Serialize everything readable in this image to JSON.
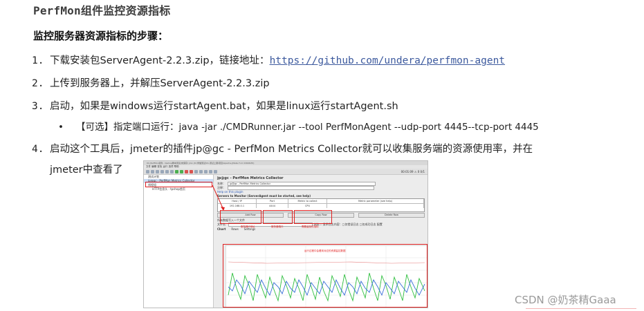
{
  "heading": "PerfMon组件监控资源指标",
  "subheading": "监控服务器资源指标的步骤：",
  "steps": [
    {
      "num": "1.",
      "text": "下载安装包ServerAgent-2.2.3.zip，链接地址：",
      "link": "https://github.com/undera/perfmon-agent"
    },
    {
      "num": "2.",
      "text": "上传到服务器上，并解压ServerAgent-2.2.3.zip"
    },
    {
      "num": "3.",
      "text": "启动，如果是windows运行startAgent.bat，如果是linux运行startAgent.sh"
    },
    {
      "num": "4.",
      "text": "启动这个工具后，jmeter的插件jp@gc - PerfMon Metrics Collector就可以收集服务端的资源使用率，并在",
      "cont": "jmeter中查看了"
    }
  ],
  "bullet": {
    "dot": "•",
    "text": "【可选】指定端口运行：java -jar ./CMDRunner.jar --tool PerfMonAgent --udp-port 4445--tcp-port 4445"
  },
  "screenshot": {
    "window_title": "04_PerfMon组件 - tpshop脚本测试(未保存)  jmx (D:\\学堂测试\\01-测试上课\\项目\\Apache-JMeter 5.0 r1840935)",
    "menu": "文件  编辑  查找  运行  选项  帮助",
    "timer": "00:01:09  ⚠ 0  0/1",
    "tree": [
      "测试计划",
      "jp@gc - PerfMon Metrics Collector",
      "线程组",
      "HTTP信息头 - tpshop首页"
    ],
    "panel_title": "jp@gc - PerfMon Metrics Collector",
    "name_label": "名称：",
    "name_value": "jp@gc - PerfMon Metrics Collector",
    "comment_label": "注释：",
    "help_link": "Help on this plugin",
    "section": "Servers to Monitor (ServerAgent must be started, see help)",
    "columns": [
      "Host / IP",
      "Port",
      "Metric to collect",
      "Metric parameter (see help)"
    ],
    "row": [
      "192.168.0.1",
      "4444",
      "CPU",
      ""
    ],
    "buttons": [
      "Add Row",
      "Copy Row",
      "Delete Row"
    ],
    "file_label": "所有数据写入一个文件",
    "file_name_label": "文件名",
    "browse": "浏览...",
    "log_options": "显示日志内容：□仅错误日志  □仅成功日志  配置",
    "tabs": [
      "Chart",
      "Rows",
      "Settings"
    ],
    "annotations": {
      "host": "服务器IP地址",
      "port": "服务器端口",
      "metric": "需要监控的指标",
      "chart": "运行过程中会看到对应的资源监控数据"
    }
  },
  "watermark": "CSDN @奶茶精Gaaa",
  "colors": {
    "link": "#3d5a9e",
    "annotation_red": "#e02020",
    "line_green": "#2fbf3f",
    "line_blue": "#3a6fd8"
  }
}
